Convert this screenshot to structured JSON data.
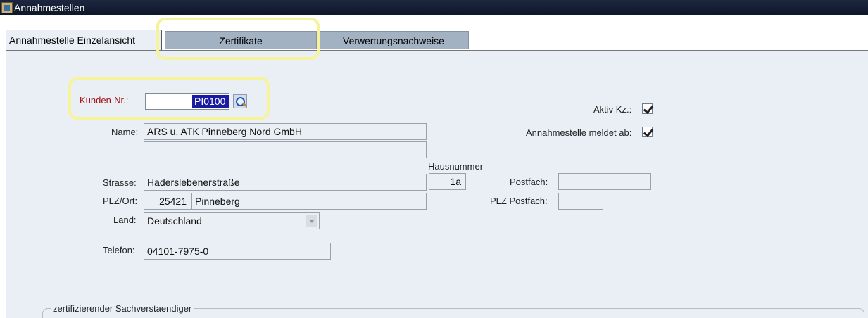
{
  "window": {
    "title": "Annahmestellen"
  },
  "tabs": [
    {
      "label": "Annahmestelle Einzelansicht"
    },
    {
      "label": "Zertifikate"
    },
    {
      "label": "Verwertungsnachweise"
    }
  ],
  "form": {
    "kunden_nr": {
      "label": "Kunden-Nr.:",
      "value": "PI0100"
    },
    "name": {
      "label": "Name:",
      "line1": "ARS u. ATK Pinneberg Nord GmbH",
      "line2": ""
    },
    "hausnummer": {
      "label": "Hausnummer",
      "value": "1a"
    },
    "strasse": {
      "label": "Strasse:",
      "value": "Haderslebenerstraße"
    },
    "plz_ort": {
      "label": "PLZ/Ort:",
      "plz": "25421",
      "ort": "Pinneberg"
    },
    "land": {
      "label": "Land:",
      "value": "Deutschland"
    },
    "telefon": {
      "label": "Telefon:",
      "value": "04101-7975-0"
    },
    "postfach": {
      "label": "Postfach:",
      "value": ""
    },
    "plz_postfach": {
      "label": "PLZ Postfach:",
      "value": ""
    },
    "aktiv_kz": {
      "label": "Aktiv Kz.:",
      "checked": true
    },
    "meldet_ab": {
      "label": "Annahmestelle meldet ab:",
      "checked": true
    }
  },
  "group": {
    "title": "zertifizierender Sachverstaendiger"
  },
  "colors": {
    "title_bar": "#0e1628",
    "panel": "#eaeff5",
    "inactive_tab": "#a3b2c3",
    "highlight": "#f6f39a",
    "required_label": "#a41010",
    "selection": "#1a1aa0"
  }
}
